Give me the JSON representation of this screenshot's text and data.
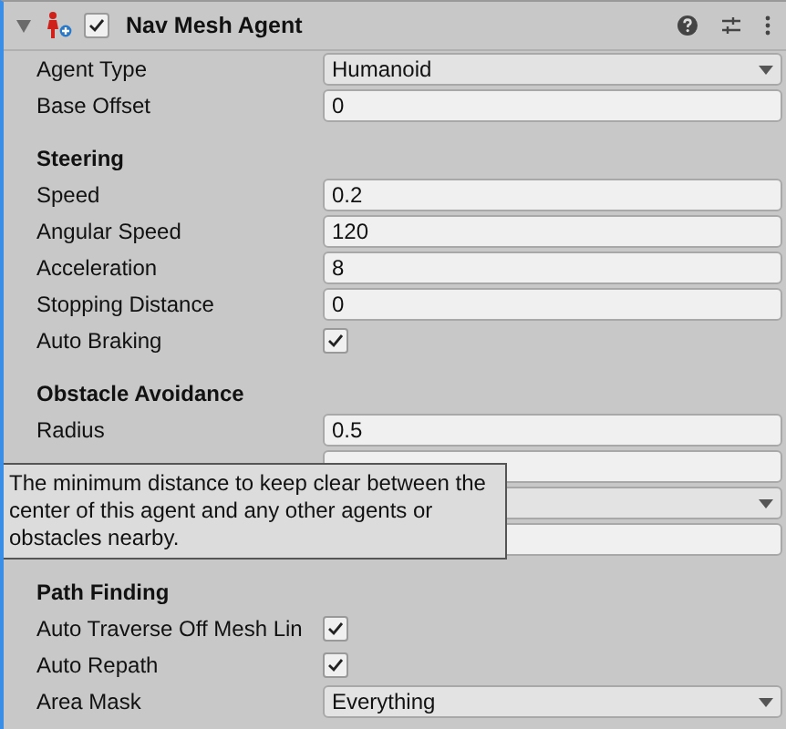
{
  "component": {
    "title": "Nav Mesh Agent",
    "enabled": true,
    "expanded": true
  },
  "sections": [
    {
      "rows": [
        {
          "kind": "dropdown",
          "label": "Agent Type",
          "value": "Humanoid"
        },
        {
          "kind": "field",
          "label": "Base Offset",
          "value": "0"
        }
      ]
    },
    {
      "title": "Steering",
      "rows": [
        {
          "kind": "field",
          "label": "Speed",
          "value": "0.2"
        },
        {
          "kind": "field",
          "label": "Angular Speed",
          "value": "120"
        },
        {
          "kind": "field",
          "label": "Acceleration",
          "value": "8"
        },
        {
          "kind": "field",
          "label": "Stopping Distance",
          "value": "0"
        },
        {
          "kind": "checkbox",
          "label": "Auto Braking",
          "checked": true
        }
      ]
    },
    {
      "title": "Obstacle Avoidance",
      "rows": [
        {
          "kind": "field",
          "label": "Radius",
          "value": "0.5"
        },
        {
          "kind": "field"
        },
        {
          "kind": "dropdown"
        },
        {
          "kind": "field"
        }
      ]
    },
    {
      "title": "Path Finding",
      "rows": [
        {
          "kind": "checkbox",
          "label": "Auto Traverse Off Mesh Lin",
          "checked": true
        },
        {
          "kind": "checkbox",
          "label": "Auto Repath",
          "checked": true
        },
        {
          "kind": "dropdown",
          "label": "Area Mask",
          "value": "Everything"
        }
      ]
    }
  ],
  "tooltip": {
    "text": "The minimum distance to keep clear between the center of this agent and any other agents or obstacles nearby."
  }
}
